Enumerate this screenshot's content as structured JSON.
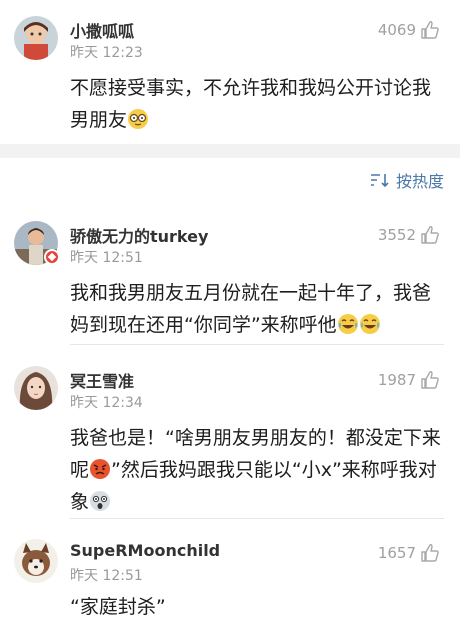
{
  "sort": {
    "label": "按热度"
  },
  "comments": [
    {
      "username": "小撒呱呱",
      "time": "昨天 12:23",
      "likes": "4069",
      "text": "不愿接受事实，不允许我和我妈公开讨论我男朋友",
      "emoji": "glasses-face"
    },
    {
      "username": "骄傲无力的turkey",
      "time": "昨天 12:51",
      "likes": "3552",
      "text": "我和我男朋友五月份就在一起十年了，我爸妈到现在还用“你同学”来称呼他",
      "emoji": "laugh-cry-face"
    },
    {
      "username": "冥王雪准",
      "time": "昨天 12:34",
      "likes": "1987",
      "text_part1": "我爸也是！“啥男朋友男朋友的！都没定下来呢",
      "text_part2": "”然后我妈跟我只能以“小x”来称呼我对象",
      "emoji1": "angry-face",
      "emoji2": "shocked-face"
    },
    {
      "username": "SupeRMoonchild",
      "time": "昨天 12:51",
      "likes": "1657",
      "text": "“家庭封杀”"
    }
  ],
  "colors": {
    "accent": "#4a78a8",
    "muted": "#9a9a9a",
    "badge": "#e8423b"
  }
}
